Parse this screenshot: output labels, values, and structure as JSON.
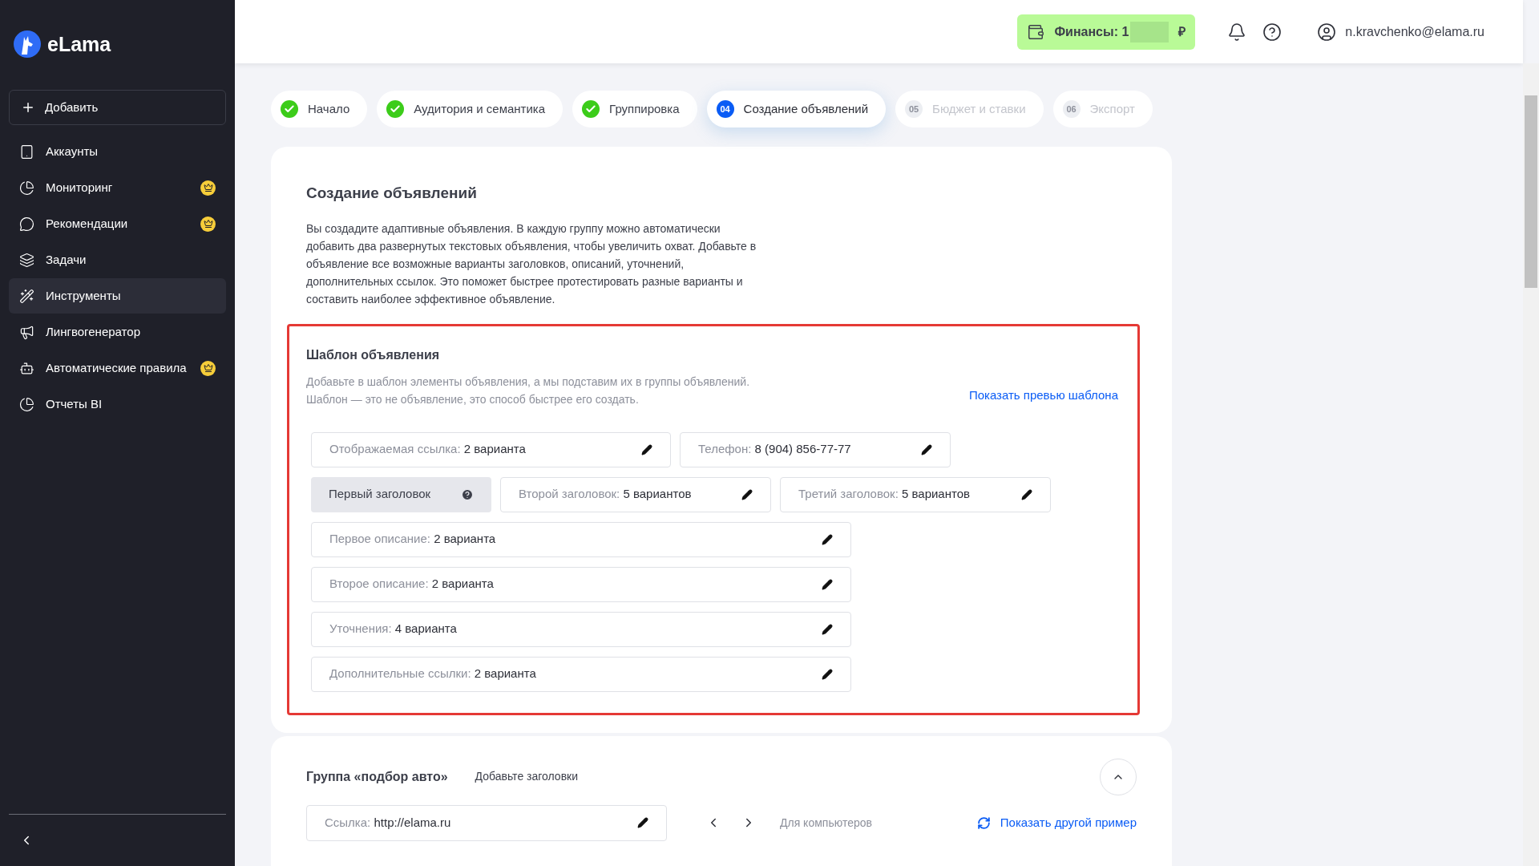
{
  "sidebar": {
    "logo": "eLama",
    "add_button": "Добавить",
    "items": [
      {
        "label": "Аккаунты",
        "premium": false,
        "selected": false
      },
      {
        "label": "Мониторинг",
        "premium": true,
        "selected": false
      },
      {
        "label": "Рекомендации",
        "premium": true,
        "selected": false
      },
      {
        "label": "Задачи",
        "premium": false,
        "selected": false
      },
      {
        "label": "Инструменты",
        "premium": false,
        "selected": true
      },
      {
        "label": "Лингвогенератор",
        "premium": false,
        "selected": false
      },
      {
        "label": "Автоматические правила",
        "premium": true,
        "selected": false
      },
      {
        "label": "Отчеты BI",
        "premium": false,
        "selected": false
      }
    ]
  },
  "header": {
    "finance_label": "Финансы: 1",
    "currency": "₽",
    "user": "n.kravchenko@elama.ru"
  },
  "steps": [
    {
      "label": "Начало",
      "done": true,
      "selected": false
    },
    {
      "label": "Аудитория и семантика",
      "done": true,
      "selected": false
    },
    {
      "label": "Группировка",
      "done": true,
      "selected": false
    },
    {
      "label": "Создание объявлений",
      "number": "04",
      "done": false,
      "selected": true
    },
    {
      "label": "Бюджет и ставки",
      "number": "05",
      "done": false,
      "selected": false
    },
    {
      "label": "Экспорт",
      "number": "06",
      "done": false,
      "selected": false
    }
  ],
  "intro": {
    "title": "Создание объявлений",
    "text": "Вы создадите адаптивные объявления. В каждую группу можно автоматически добавить два развернутых текстовых объявления, чтобы увеличить охват. Добавьте в объявление все возможные варианты заголовков, описаний, уточнений, дополнительных ссылок. Это поможет быстрее протестировать разные варианты и составить наиболее эффективное объявление."
  },
  "template": {
    "title": "Шаблон объявления",
    "text": "Добавьте в шаблон элементы объявления, а мы подставим их в группы объявлений. Шаблон — это не объявление, это способ быстрее его создать.",
    "preview_link": "Показать превью шаблона",
    "rows": [
      [
        {
          "kind": "value",
          "label": "Отображаемая ссылка:",
          "value": "2 варианта"
        },
        {
          "kind": "value",
          "label": "Телефон:",
          "value": "8 (904) 856-77-77"
        }
      ],
      [
        {
          "kind": "empty",
          "label": "Первый заголовок"
        },
        {
          "kind": "value",
          "label": "Второй заголовок:",
          "value": "5 вариантов"
        },
        {
          "kind": "value",
          "label": "Третий заголовок:",
          "value": "5 вариантов"
        }
      ],
      [
        {
          "kind": "value",
          "label": "Первое описание:",
          "value": "2 варианта"
        }
      ],
      [
        {
          "kind": "value",
          "label": "Второе описание:",
          "value": "2 варианта"
        }
      ],
      [
        {
          "kind": "value",
          "label": "Уточнения:",
          "value": "4 варианта"
        }
      ],
      [
        {
          "kind": "value",
          "label": "Дополнительные ссылки:",
          "value": "2 варианта"
        }
      ]
    ]
  },
  "group": {
    "title": "Группа «подбор авто»",
    "hint": "Добавьте заголовки",
    "expanded": true,
    "link_label": "Ссылка:",
    "link_value": "http://elama.ru",
    "device": "Для компьютеров",
    "other_example": "Показать другой пример"
  }
}
